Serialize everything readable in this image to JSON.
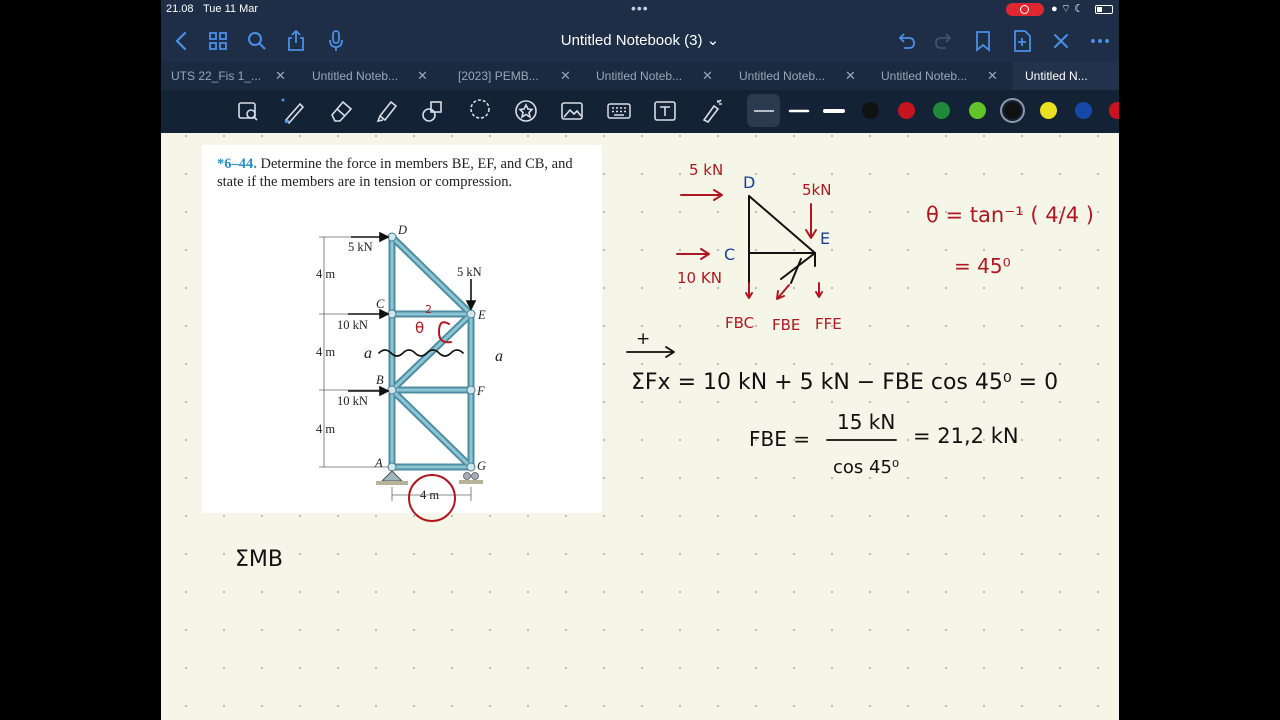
{
  "status_bar": {
    "time": "21.08",
    "date": "Tue 11 Mar",
    "more_dots": "•••"
  },
  "nav": {
    "title": "Untitled Notebook (3) ⌄"
  },
  "tabs": [
    {
      "label": "UTS 22_Fis 1_...",
      "active": false
    },
    {
      "label": "Untitled Noteb...",
      "active": false
    },
    {
      "label": "[2023] PEMB...",
      "active": false
    },
    {
      "label": "Untitled Noteb...",
      "active": false
    },
    {
      "label": "Untitled Noteb...",
      "active": false
    },
    {
      "label": "Untitled Noteb...",
      "active": false
    },
    {
      "label": "Untitled N...",
      "active": true
    }
  ],
  "toolbar": {
    "tools": [
      "zoom-lasso-icon",
      "pen-icon",
      "eraser-icon",
      "highlighter-icon",
      "shapes-icon",
      "lasso-icon",
      "sticker-icon",
      "image-icon",
      "keyboard-icon",
      "text-icon",
      "laser-pointer-icon"
    ],
    "colors": [
      "#111111",
      "#c8141e",
      "#1f8a3a",
      "#62c42a",
      "#111111",
      "#e8e020",
      "#1648a8"
    ]
  },
  "problem": {
    "number": "*6–44.",
    "text": "Determine the force in members BE, EF, and CB, and state if the members are in tension or compression."
  },
  "truss_labels": {
    "D": "D",
    "C": "C",
    "E": "E",
    "B": "B",
    "F": "F",
    "A": "A",
    "G": "G",
    "load_top": "5 kN",
    "load_right": "5 kN",
    "load_c": "10 kN",
    "load_b": "10 kN",
    "h1": "4 m",
    "h2": "4 m",
    "h3": "4 m",
    "width": "4 m",
    "cut_a_left": "a",
    "cut_a_right": "a",
    "theta": "θ",
    "two": "2"
  },
  "notes": {
    "fbd": {
      "load_5kn_left": "5 kN",
      "load_5kn_right": "5kN",
      "load_10kn": "10 KN",
      "D": "D",
      "C": "C",
      "E": "E",
      "fbc": "FBC",
      "fbe": "FBE",
      "ffe": "FFE"
    },
    "theta_eq_1": "θ = tan⁻¹ ( 4/4 )",
    "theta_eq_2": "= 45⁰",
    "plus_sign": "+",
    "sum_fx": "ΣFx = 10 kN + 5 kN − FBE cos 45⁰ = 0",
    "fbe_label": "FBE =",
    "fbe_num": "15 kN",
    "fbe_den": "cos 45⁰",
    "fbe_result": "= 21,2 kN",
    "sum_mb": "ΣMB"
  }
}
